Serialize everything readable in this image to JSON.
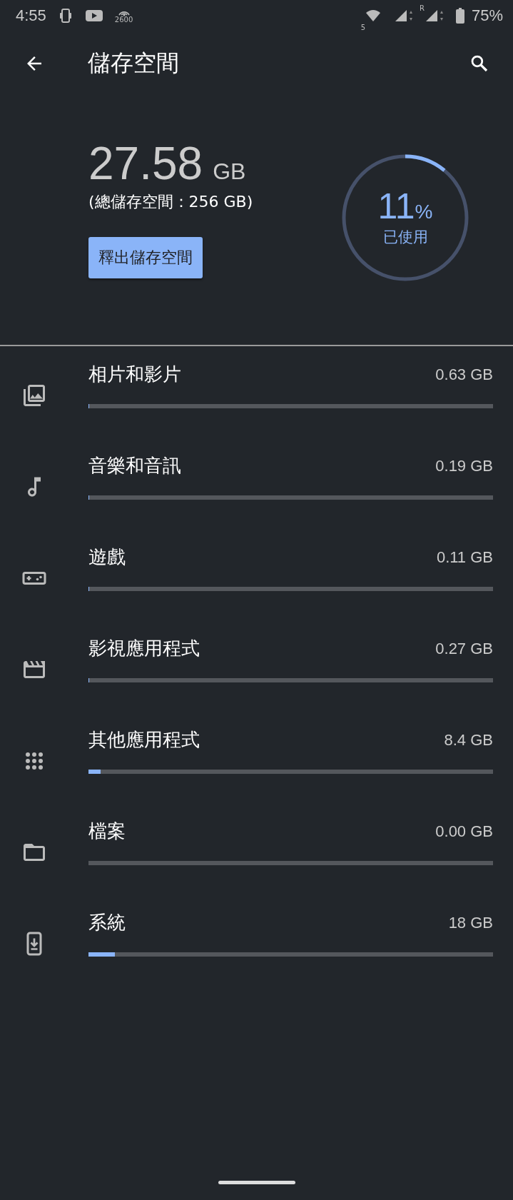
{
  "status_bar": {
    "time": "4:55",
    "network_label": "2600",
    "wifi_band": "5",
    "sim_label": "R",
    "battery": "75%"
  },
  "toolbar": {
    "title": "儲存空間"
  },
  "summary": {
    "used": "27.58",
    "unit": "GB",
    "total": "(總儲存空間：256 GB)",
    "button": "釋出儲存空間",
    "percent": "11",
    "percent_sign": "%",
    "used_label": "已使用",
    "level": 0.11
  },
  "categories": [
    {
      "kind": "photos",
      "label": "相片和影片",
      "size": "0.63 GB",
      "level": 0.002
    },
    {
      "kind": "music",
      "label": "音樂和音訊",
      "size": "0.19 GB",
      "level": 0.001
    },
    {
      "kind": "games",
      "label": "遊戲",
      "size": "0.11 GB",
      "level": 0.0005
    },
    {
      "kind": "movies",
      "label": "影視應用程式",
      "size": "0.27 GB",
      "level": 0.001
    },
    {
      "kind": "apps",
      "label": "其他應用程式",
      "size": "8.4 GB",
      "level": 0.03
    },
    {
      "kind": "files",
      "label": "檔案",
      "size": "0.00 GB"
    },
    {
      "kind": "system",
      "label": "系統",
      "size": "18 GB",
      "level": 0.066
    }
  ]
}
